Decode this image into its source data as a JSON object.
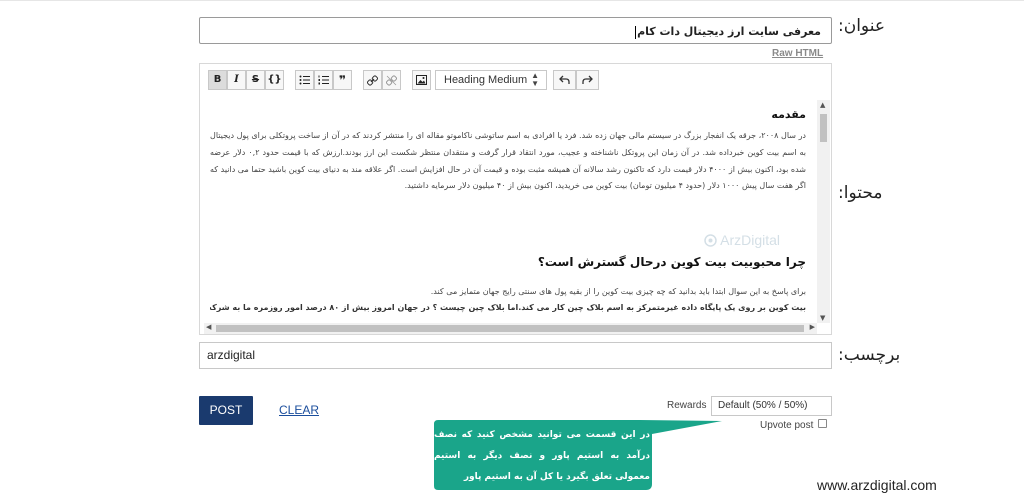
{
  "labels": {
    "title": "عنوان:",
    "content": "محتوا:",
    "tags": "برچسب:"
  },
  "title_input": {
    "value": "معرفی سایت ارز دیجیتال دات کام"
  },
  "raw_html_link": "Raw HTML",
  "toolbar": {
    "bold": "B",
    "italic": "I",
    "strike": "S",
    "code": "{}",
    "bullet_list_icon": "bullet-list-icon",
    "numbered_list_icon": "numbered-list-icon",
    "quote": "❞",
    "link_icon": "link-icon",
    "unlink_icon": "unlink-icon",
    "image_icon": "image-icon",
    "heading_select": "Heading Medium",
    "undo_icon": "undo-icon",
    "redo_icon": "redo-icon"
  },
  "editor": {
    "heading1": "مقدمه",
    "paragraph1": "در سال ۲۰۰۸، جرقه یک انفجار بزرگ در سیستم مالی جهان زده شد. فرد یا افرادی به اسم ساتوشی ناکاموتو مقاله ای را منتشر کردند که در آن از ساخت پروتکلی برای پول دیجیتال به اسم بیت کوین خبرداده شد. در آن زمان این پروتکل ناشناخته و عجیب، مورد انتقاد قرار گرفت و منتقدان منتظر شکست این ارز بودند.ارزش که با قیمت حدود ۰,۲ دلار عرضه شده بود، اکنون بیش از ۴۰۰۰ دلار قیمت دارد که تاکنون رشد سالانه آن همیشه مثبت بوده و قیمت آن در حال افزایش است. اگر علاقه مند به دنیای بیت کوین باشید حتما می دانید که اگر هفت سال پیش ۱۰۰۰ دلار (حدود ۴ میلیون تومان) بیت کوین می خریدید، اکنون بیش از ۴۰ میلیون دلار سرمایه داشتید.",
    "watermark": "ArzDigital",
    "heading2": "چرا محبوبیت بیت کوین درحال گسترش است؟",
    "paragraph2": "برای پاسخ به این سوال ابتدا باید بدانید که چه چیزی بیت کوین را از بقیه پول های سنتی رایج جهان متمایز می کند.",
    "paragraph3": "بیت کوین بر روی یک پایگاه داده غیرمتمرکز به اسم بلاک چین کار می کند.اما بلاک چین چیست ؟ در جهان امروز بیش از ۸۰ درصد امور روزمره ما به شرکت"
  },
  "tags_input": {
    "value": "arzdigital"
  },
  "post_button": "POST",
  "clear_link": "CLEAR",
  "rewards": {
    "label": "Rewards",
    "selected": "Default (50% / 50%)"
  },
  "upvote": {
    "label": "Upvote post",
    "checked": false
  },
  "callout": {
    "text": "در این قسمت می توانید مشخص کنید که نصف درآمد به استیم پاور و نصف دیگر به استیم معمولی تعلق بگیرد یا کل آن به استیم پاور",
    "color": "#1aa58a"
  },
  "footer_url": "www.arzdigital.com"
}
